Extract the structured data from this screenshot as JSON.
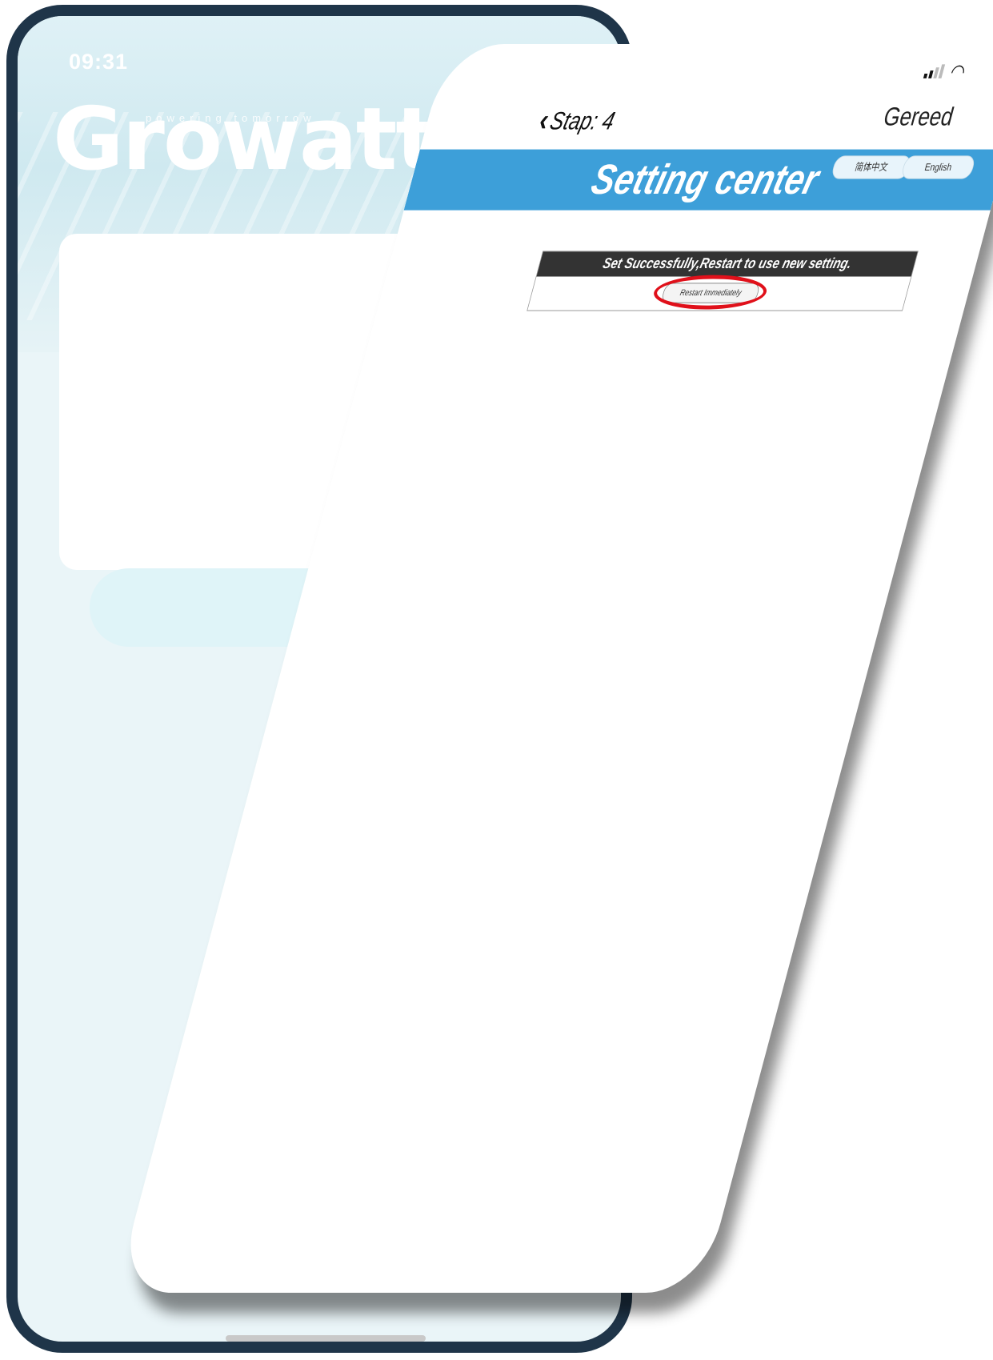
{
  "background_app": {
    "time": "09:31",
    "logo": "Growatt",
    "slogan": "powering tomorrow"
  },
  "status_bar": {
    "signal_icon": "signal-icon",
    "wifi_icon": "wifi-icon"
  },
  "nav": {
    "back_label": "Stap: 4",
    "done_label": "Gereed"
  },
  "header": {
    "title": "Setting center",
    "lang_zh": "简体中文",
    "lang_en": "English",
    "color": "#3d9fd9"
  },
  "notice": {
    "message": "Set Successfully,Restart to use new setting.",
    "restart_label": "Restart Immediately",
    "highlight_color": "#e0101a"
  }
}
